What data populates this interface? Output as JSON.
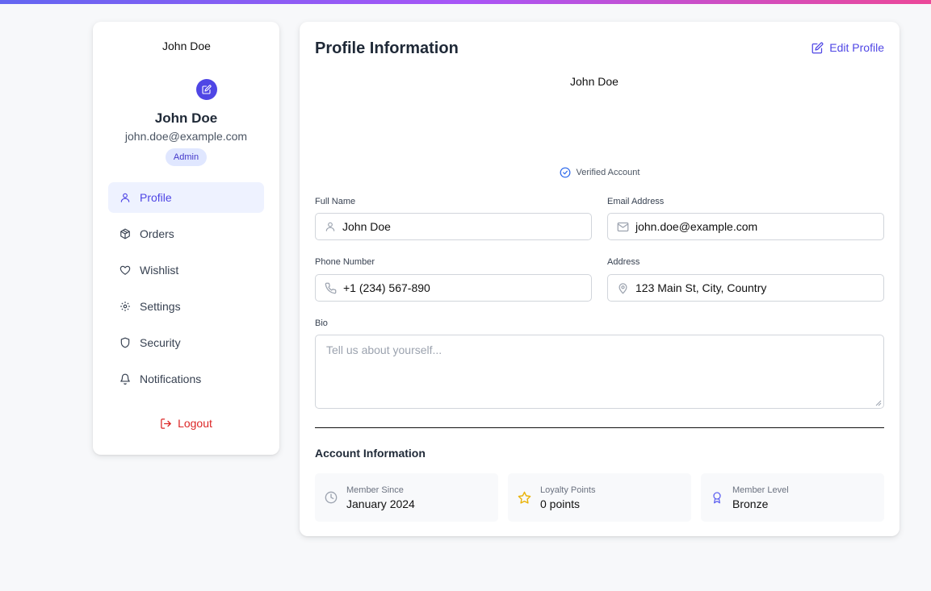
{
  "sidebar": {
    "avatar_alt": "John Doe",
    "name": "John Doe",
    "email": "john.doe@example.com",
    "role": "Admin",
    "items": [
      {
        "label": "Profile",
        "icon": "user-icon"
      },
      {
        "label": "Orders",
        "icon": "package-icon"
      },
      {
        "label": "Wishlist",
        "icon": "heart-icon"
      },
      {
        "label": "Settings",
        "icon": "gear-icon"
      },
      {
        "label": "Security",
        "icon": "shield-icon"
      },
      {
        "label": "Notifications",
        "icon": "bell-icon"
      }
    ],
    "logout_label": "Logout"
  },
  "main": {
    "title": "Profile Information",
    "edit_label": "Edit Profile",
    "avatar_alt": "John Doe",
    "verified_label": "Verified Account",
    "fields": {
      "full_name": {
        "label": "Full Name",
        "value": "John Doe"
      },
      "email": {
        "label": "Email Address",
        "value": "john.doe@example.com"
      },
      "phone": {
        "label": "Phone Number",
        "value": "+1 (234) 567-890"
      },
      "address": {
        "label": "Address",
        "value": "123 Main St, City, Country"
      },
      "bio": {
        "label": "Bio",
        "placeholder": "Tell us about yourself..."
      }
    },
    "account": {
      "title": "Account Information",
      "stats": [
        {
          "label": "Member Since",
          "value": "January 2024",
          "icon": "clock-icon"
        },
        {
          "label": "Loyalty Points",
          "value": "0 points",
          "icon": "star-icon"
        },
        {
          "label": "Member Level",
          "value": "Bronze",
          "icon": "award-icon"
        }
      ]
    }
  },
  "colors": {
    "accent": "#4f46e5",
    "active_bg": "#eef2ff",
    "logout": "#dc2626",
    "verified": "#2563eb",
    "star": "#eab308"
  }
}
